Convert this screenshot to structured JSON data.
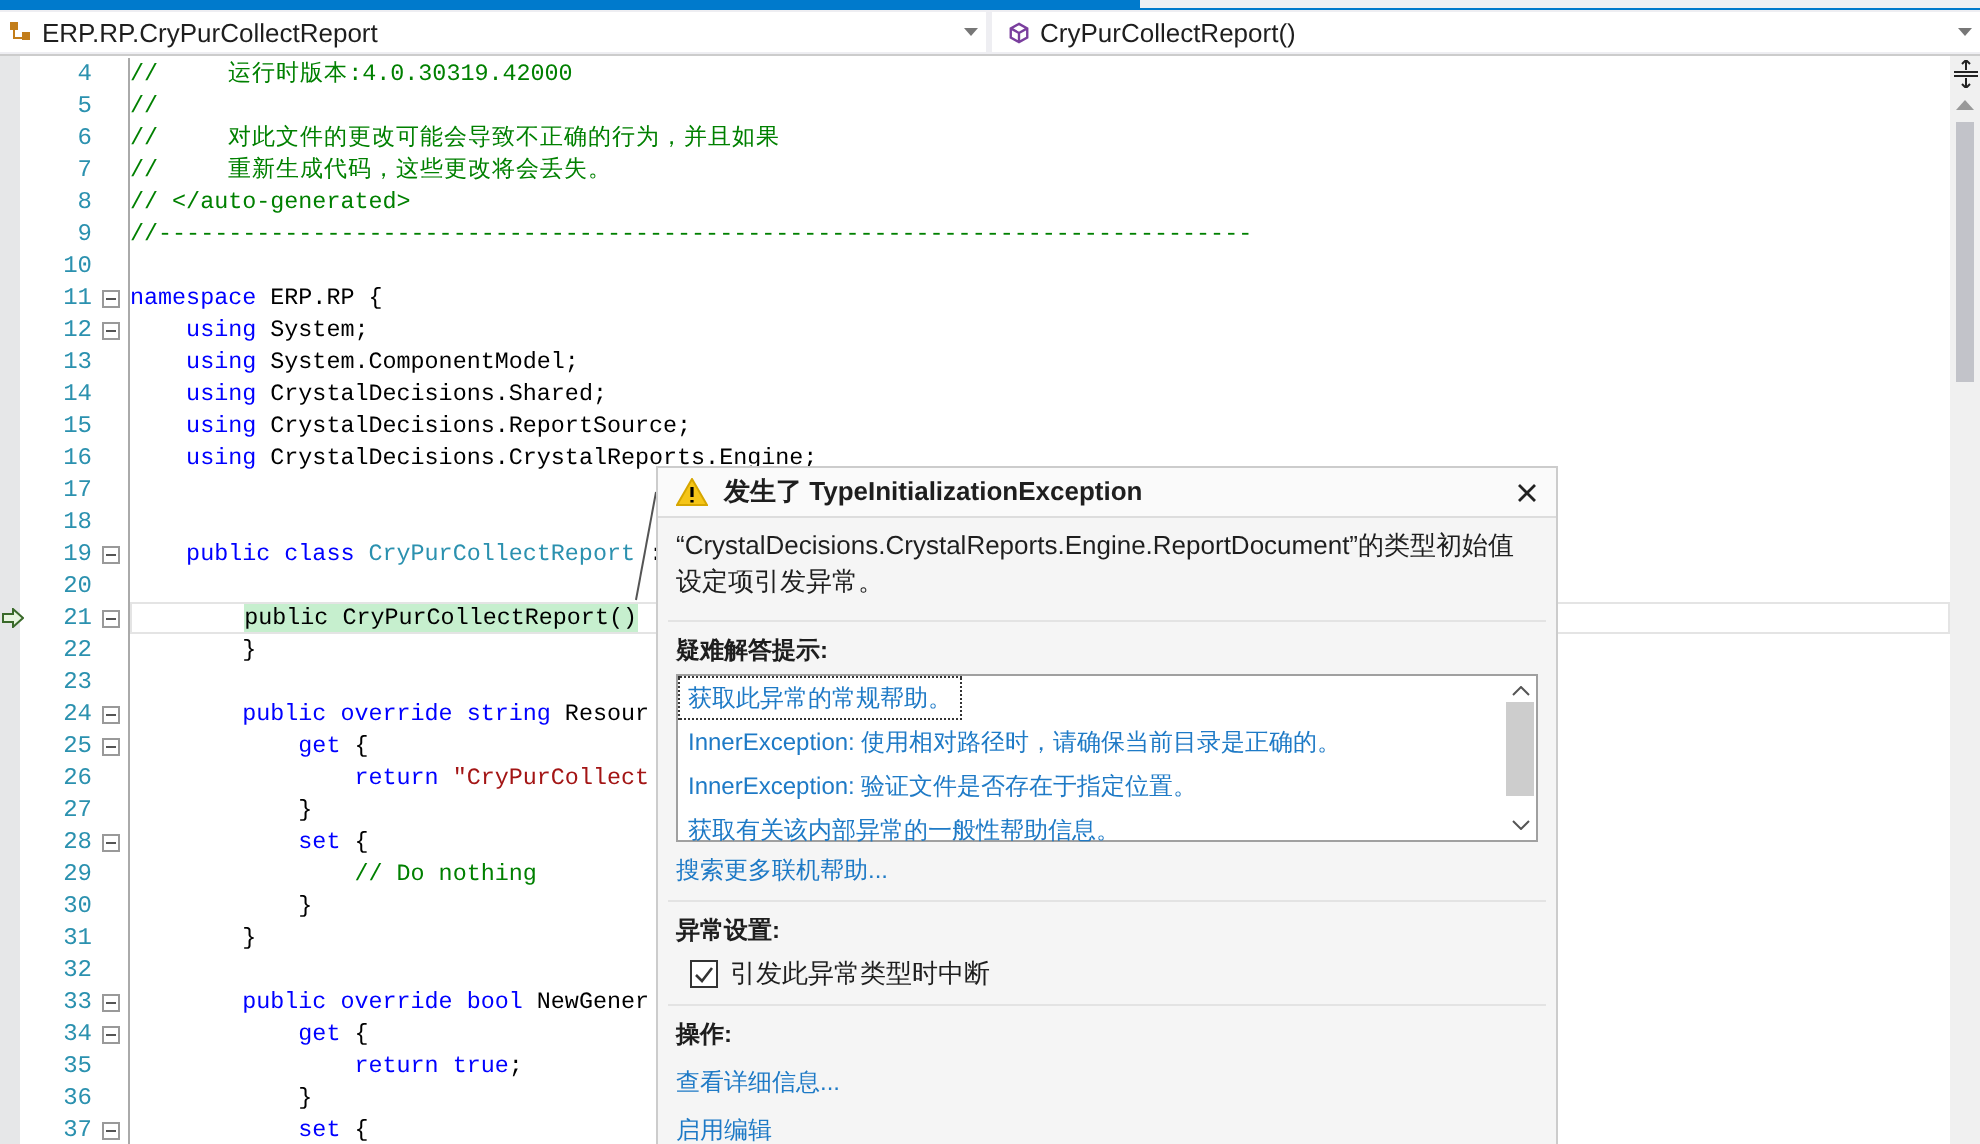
{
  "nav_bar": {
    "type_dropdown": "ERP.RP.CryPurCollectReport",
    "member_dropdown": "CryPurCollectReport()"
  },
  "code_lines": [
    {
      "num": "4",
      "fold": false,
      "current": false,
      "segs": [
        {
          "kind": "comment",
          "text": "//     运行时版本:4.0.30319.42000"
        }
      ]
    },
    {
      "num": "5",
      "fold": false,
      "current": false,
      "segs": [
        {
          "kind": "comment",
          "text": "//"
        }
      ]
    },
    {
      "num": "6",
      "fold": false,
      "current": false,
      "segs": [
        {
          "kind": "comment",
          "text": "//     对此文件的更改可能会导致不正确的行为，并且如果"
        }
      ]
    },
    {
      "num": "7",
      "fold": false,
      "current": false,
      "segs": [
        {
          "kind": "comment",
          "text": "//     重新生成代码，这些更改将会丢失。"
        }
      ]
    },
    {
      "num": "8",
      "fold": false,
      "current": false,
      "segs": [
        {
          "kind": "comment",
          "text": "// </auto-generated>"
        }
      ]
    },
    {
      "num": "9",
      "fold": false,
      "current": false,
      "segs": [
        {
          "kind": "comment",
          "text": "//------------------------------------------------------------------------------"
        }
      ]
    },
    {
      "num": "10",
      "fold": false,
      "current": false
    },
    {
      "num": "11",
      "fold": true,
      "current": false,
      "segs": [
        {
          "kind": "keyword",
          "text": "namespace"
        },
        {
          "kind": "plain",
          "text": " ERP.RP {"
        }
      ]
    },
    {
      "num": "12",
      "fold": true,
      "current": false,
      "segs": [
        {
          "kind": "keyword",
          "text": "    using"
        },
        {
          "kind": "plain",
          "text": " System;"
        }
      ]
    },
    {
      "num": "13",
      "fold": false,
      "current": false,
      "segs": [
        {
          "kind": "keyword",
          "text": "    using"
        },
        {
          "kind": "plain",
          "text": " System.ComponentModel;"
        }
      ]
    },
    {
      "num": "14",
      "fold": false,
      "current": false,
      "segs": [
        {
          "kind": "keyword",
          "text": "    using"
        },
        {
          "kind": "plain",
          "text": " CrystalDecisions.Shared;"
        }
      ]
    },
    {
      "num": "15",
      "fold": false,
      "current": false,
      "segs": [
        {
          "kind": "keyword",
          "text": "    using"
        },
        {
          "kind": "plain",
          "text": " CrystalDecisions.ReportSource;"
        }
      ]
    },
    {
      "num": "16",
      "fold": false,
      "current": false,
      "segs": [
        {
          "kind": "keyword",
          "text": "    using"
        },
        {
          "kind": "plain",
          "text": " CrystalDecisions.CrystalReports.Engine;"
        }
      ]
    },
    {
      "num": "17",
      "fold": false,
      "current": false
    },
    {
      "num": "18",
      "fold": false,
      "current": false
    },
    {
      "num": "19",
      "fold": true,
      "current": false,
      "segs": [
        {
          "kind": "keyword",
          "text": "    public class"
        },
        {
          "kind": "type",
          "text": " CryPurCollectReport"
        },
        {
          "kind": "plain",
          "text": " :"
        }
      ]
    },
    {
      "num": "20",
      "fold": false,
      "current": false
    },
    {
      "num": "21",
      "fold": true,
      "current": true,
      "segs": [
        {
          "kind": "highlighted",
          "text": "        public CryPurCollectReport()"
        }
      ]
    },
    {
      "num": "22",
      "fold": false,
      "current": false,
      "segs": [
        {
          "kind": "plain",
          "text": "        }"
        }
      ]
    },
    {
      "num": "23",
      "fold": false,
      "current": false
    },
    {
      "num": "24",
      "fold": true,
      "current": false,
      "segs": [
        {
          "kind": "keyword",
          "text": "        public override string"
        },
        {
          "kind": "plain",
          "text": " Resour"
        }
      ]
    },
    {
      "num": "25",
      "fold": true,
      "current": false,
      "segs": [
        {
          "kind": "keyword",
          "text": "            get"
        },
        {
          "kind": "plain",
          "text": " {"
        }
      ]
    },
    {
      "num": "26",
      "fold": false,
      "current": false,
      "segs": [
        {
          "kind": "keyword",
          "text": "                return"
        },
        {
          "kind": "string",
          "text": " \"CryPurCollect"
        }
      ]
    },
    {
      "num": "27",
      "fold": false,
      "current": false,
      "segs": [
        {
          "kind": "plain",
          "text": "            }"
        }
      ]
    },
    {
      "num": "28",
      "fold": true,
      "current": false,
      "segs": [
        {
          "kind": "keyword",
          "text": "            set"
        },
        {
          "kind": "plain",
          "text": " {"
        }
      ]
    },
    {
      "num": "29",
      "fold": false,
      "current": false,
      "segs": [
        {
          "kind": "comment",
          "text": "                // Do nothing"
        }
      ]
    },
    {
      "num": "30",
      "fold": false,
      "current": false,
      "segs": [
        {
          "kind": "plain",
          "text": "            }"
        }
      ]
    },
    {
      "num": "31",
      "fold": false,
      "current": false,
      "segs": [
        {
          "kind": "plain",
          "text": "        }"
        }
      ]
    },
    {
      "num": "32",
      "fold": false,
      "current": false
    },
    {
      "num": "33",
      "fold": true,
      "current": false,
      "segs": [
        {
          "kind": "keyword",
          "text": "        public override bool"
        },
        {
          "kind": "plain",
          "text": " NewGener"
        }
      ]
    },
    {
      "num": "34",
      "fold": true,
      "current": false,
      "segs": [
        {
          "kind": "keyword",
          "text": "            get"
        },
        {
          "kind": "plain",
          "text": " {"
        }
      ]
    },
    {
      "num": "35",
      "fold": false,
      "current": false,
      "segs": [
        {
          "kind": "keyword",
          "text": "                return true"
        },
        {
          "kind": "plain",
          "text": ";"
        }
      ]
    },
    {
      "num": "36",
      "fold": false,
      "current": false,
      "segs": [
        {
          "kind": "plain",
          "text": "            }"
        }
      ]
    },
    {
      "num": "37",
      "fold": true,
      "current": false,
      "segs": [
        {
          "kind": "keyword",
          "text": "            set"
        },
        {
          "kind": "plain",
          "text": " {"
        }
      ]
    }
  ],
  "exception_popup": {
    "title": "发生了 TypeInitializationException",
    "message": "“CrystalDecisions.CrystalReports.Engine.ReportDocument”的类型初始值设定项引发异常。",
    "tips_heading": "疑难解答提示:",
    "tips": [
      {
        "text": "获取此异常的常规帮助。",
        "selected": true
      },
      {
        "text": "InnerException: 使用相对路径时，请确保当前目录是正确的。",
        "selected": false
      },
      {
        "text": "InnerException: 验证文件是否存在于指定位置。",
        "selected": false
      },
      {
        "text": "获取有关该内部异常的一般性帮助信息。",
        "selected": false
      }
    ],
    "search_link": "搜索更多联机帮助...",
    "settings_heading": "异常设置:",
    "break_option": {
      "label": "引发此异常类型时中断",
      "checked": true
    },
    "actions_heading": "操作:",
    "actions": [
      "查看详细信息...",
      "启用编辑"
    ]
  }
}
